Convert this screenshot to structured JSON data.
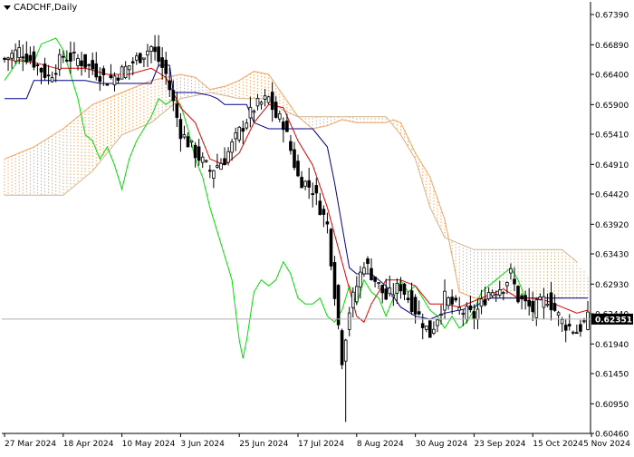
{
  "header": {
    "symbol_label": "CADCHF,Daily"
  },
  "colors": {
    "background": "#ffffff",
    "candle": "#000000",
    "tenkan": "#e00000",
    "kijun": "#00008b",
    "chikou": "#00dd00",
    "senkou_a": "#f4a460",
    "senkou_b": "#d2b48c",
    "price_tag": "#000000",
    "grid_frame": "#000000"
  },
  "chart_data": {
    "type": "candlestick",
    "symbol": "CADCHF",
    "timeframe": "Daily",
    "indicator": "Ichimoku Kinko Hyo",
    "ylim": [
      0.6046,
      0.676
    ],
    "y_ticks": [
      "0.67390",
      "0.66890",
      "0.66400",
      "0.65900",
      "0.65410",
      "0.64910",
      "0.64420",
      "0.63920",
      "0.63430",
      "0.62930",
      "0.62440",
      "0.61940",
      "0.61450",
      "0.60950",
      "0.60460"
    ],
    "x_ticks": [
      "27 Mar 2024",
      "18 Apr 2024",
      "10 May 2024",
      "3 Jun 2024",
      "25 Jun 2024",
      "17 Jul 2024",
      "8 Aug 2024",
      "30 Aug 2024",
      "23 Sep 2024",
      "15 Oct 2024",
      "5 Nov 2024"
    ],
    "x_tick_index": [
      0,
      16,
      32,
      48,
      64,
      80,
      96,
      112,
      128,
      144,
      160
    ],
    "current_price": "0.62351",
    "close_points": [
      [
        0,
        0.6665
      ],
      [
        4,
        0.668
      ],
      [
        8,
        0.666
      ],
      [
        12,
        0.6635
      ],
      [
        16,
        0.667
      ],
      [
        20,
        0.6665
      ],
      [
        24,
        0.665
      ],
      [
        28,
        0.663
      ],
      [
        32,
        0.6645
      ],
      [
        36,
        0.6665
      ],
      [
        40,
        0.6685
      ],
      [
        44,
        0.664
      ],
      [
        48,
        0.6545
      ],
      [
        52,
        0.651
      ],
      [
        56,
        0.648
      ],
      [
        60,
        0.65
      ],
      [
        64,
        0.6545
      ],
      [
        68,
        0.6585
      ],
      [
        72,
        0.66
      ],
      [
        74,
        0.657
      ],
      [
        76,
        0.656
      ],
      [
        80,
        0.647
      ],
      [
        84,
        0.645
      ],
      [
        88,
        0.639
      ],
      [
        92,
        0.617
      ],
      [
        94,
        0.625
      ],
      [
        96,
        0.629
      ],
      [
        98,
        0.633
      ],
      [
        100,
        0.631
      ],
      [
        104,
        0.627
      ],
      [
        108,
        0.629
      ],
      [
        112,
        0.625
      ],
      [
        116,
        0.621
      ],
      [
        120,
        0.627
      ],
      [
        124,
        0.625
      ],
      [
        128,
        0.624
      ],
      [
        132,
        0.628
      ],
      [
        136,
        0.629
      ],
      [
        138,
        0.631
      ],
      [
        140,
        0.627
      ],
      [
        144,
        0.625
      ],
      [
        148,
        0.627
      ],
      [
        152,
        0.623
      ],
      [
        156,
        0.6215
      ],
      [
        159,
        0.6235
      ]
    ],
    "tenkan_points": [
      [
        0,
        0.6665
      ],
      [
        8,
        0.666
      ],
      [
        14,
        0.665
      ],
      [
        22,
        0.665
      ],
      [
        28,
        0.664
      ],
      [
        34,
        0.664
      ],
      [
        40,
        0.665
      ],
      [
        44,
        0.6635
      ],
      [
        48,
        0.6585
      ],
      [
        52,
        0.656
      ],
      [
        56,
        0.65
      ],
      [
        60,
        0.649
      ],
      [
        64,
        0.651
      ],
      [
        68,
        0.656
      ],
      [
        72,
        0.659
      ],
      [
        76,
        0.6585
      ],
      [
        80,
        0.653
      ],
      [
        84,
        0.649
      ],
      [
        88,
        0.642
      ],
      [
        92,
        0.633
      ],
      [
        96,
        0.624
      ],
      [
        98,
        0.623
      ],
      [
        100,
        0.626
      ],
      [
        104,
        0.63
      ],
      [
        108,
        0.63
      ],
      [
        112,
        0.629
      ],
      [
        116,
        0.626
      ],
      [
        120,
        0.626
      ],
      [
        124,
        0.6255
      ],
      [
        128,
        0.6265
      ],
      [
        132,
        0.6275
      ],
      [
        136,
        0.6285
      ],
      [
        140,
        0.627
      ],
      [
        144,
        0.627
      ],
      [
        148,
        0.6265
      ],
      [
        152,
        0.6255
      ],
      [
        156,
        0.6245
      ],
      [
        159,
        0.625
      ]
    ],
    "kijun_points": [
      [
        0,
        0.66
      ],
      [
        6,
        0.66
      ],
      [
        8,
        0.663
      ],
      [
        12,
        0.663
      ],
      [
        16,
        0.663
      ],
      [
        22,
        0.663
      ],
      [
        26,
        0.6625
      ],
      [
        30,
        0.6625
      ],
      [
        34,
        0.6625
      ],
      [
        40,
        0.6625
      ],
      [
        42,
        0.6655
      ],
      [
        45,
        0.6655
      ],
      [
        46,
        0.661
      ],
      [
        52,
        0.661
      ],
      [
        56,
        0.6605
      ],
      [
        58,
        0.66
      ],
      [
        60,
        0.659
      ],
      [
        64,
        0.659
      ],
      [
        66,
        0.659
      ],
      [
        68,
        0.656
      ],
      [
        72,
        0.655
      ],
      [
        80,
        0.655
      ],
      [
        84,
        0.655
      ],
      [
        88,
        0.652
      ],
      [
        90,
        0.646
      ],
      [
        92,
        0.639
      ],
      [
        94,
        0.632
      ],
      [
        96,
        0.631
      ],
      [
        100,
        0.631
      ],
      [
        104,
        0.629
      ],
      [
        108,
        0.6255
      ],
      [
        112,
        0.624
      ],
      [
        116,
        0.6235
      ],
      [
        120,
        0.6245
      ],
      [
        128,
        0.6255
      ],
      [
        132,
        0.627
      ],
      [
        136,
        0.627
      ],
      [
        140,
        0.627
      ],
      [
        144,
        0.627
      ],
      [
        150,
        0.627
      ],
      [
        154,
        0.627
      ],
      [
        159,
        0.627
      ]
    ],
    "chikou_points": [
      [
        0,
        0.663
      ],
      [
        4,
        0.6665
      ],
      [
        8,
        0.666
      ],
      [
        10,
        0.669
      ],
      [
        14,
        0.67
      ],
      [
        16,
        0.668
      ],
      [
        20,
        0.66
      ],
      [
        22,
        0.654
      ],
      [
        24,
        0.653
      ],
      [
        26,
        0.65
      ],
      [
        28,
        0.652
      ],
      [
        30,
        0.649
      ],
      [
        32,
        0.645
      ],
      [
        34,
        0.65
      ],
      [
        36,
        0.653
      ],
      [
        38,
        0.655
      ],
      [
        40,
        0.657
      ],
      [
        42,
        0.66
      ],
      [
        44,
        0.659
      ],
      [
        46,
        0.66
      ],
      [
        48,
        0.659
      ],
      [
        50,
        0.655
      ],
      [
        52,
        0.65
      ],
      [
        54,
        0.647
      ],
      [
        56,
        0.642
      ],
      [
        58,
        0.638
      ],
      [
        60,
        0.634
      ],
      [
        62,
        0.63
      ],
      [
        64,
        0.62
      ],
      [
        65,
        0.617
      ],
      [
        66,
        0.62
      ],
      [
        68,
        0.628
      ],
      [
        70,
        0.63
      ],
      [
        72,
        0.629
      ],
      [
        74,
        0.63
      ],
      [
        76,
        0.633
      ],
      [
        78,
        0.631
      ],
      [
        80,
        0.627
      ],
      [
        82,
        0.626
      ],
      [
        84,
        0.626
      ],
      [
        86,
        0.627
      ],
      [
        88,
        0.624
      ],
      [
        90,
        0.623
      ],
      [
        92,
        0.625
      ],
      [
        94,
        0.629
      ],
      [
        96,
        0.626
      ],
      [
        98,
        0.63
      ],
      [
        100,
        0.628
      ],
      [
        102,
        0.627
      ],
      [
        104,
        0.624
      ],
      [
        106,
        0.627
      ],
      [
        108,
        0.63
      ],
      [
        110,
        0.628
      ],
      [
        112,
        0.629
      ],
      [
        114,
        0.627
      ],
      [
        116,
        0.625
      ],
      [
        118,
        0.624
      ],
      [
        120,
        0.622
      ],
      [
        122,
        0.624
      ],
      [
        124,
        0.622
      ],
      [
        126,
        0.623
      ],
      [
        128,
        0.625
      ],
      [
        130,
        0.628
      ],
      [
        132,
        0.629
      ],
      [
        134,
        0.63
      ],
      [
        136,
        0.631
      ],
      [
        138,
        0.632
      ],
      [
        140,
        0.63
      ],
      [
        142,
        0.627
      ],
      [
        144,
        0.625
      ],
      [
        145,
        0.624
      ]
    ],
    "senkou_a_points": [
      [
        0,
        0.65
      ],
      [
        8,
        0.652
      ],
      [
        16,
        0.655
      ],
      [
        24,
        0.659
      ],
      [
        32,
        0.661
      ],
      [
        40,
        0.663
      ],
      [
        48,
        0.664
      ],
      [
        52,
        0.6635
      ],
      [
        56,
        0.6615
      ],
      [
        60,
        0.662
      ],
      [
        64,
        0.663
      ],
      [
        68,
        0.6645
      ],
      [
        72,
        0.664
      ],
      [
        76,
        0.6605
      ],
      [
        80,
        0.657
      ],
      [
        84,
        0.655
      ],
      [
        88,
        0.6555
      ],
      [
        92,
        0.6565
      ],
      [
        96,
        0.656
      ],
      [
        100,
        0.656
      ],
      [
        104,
        0.656
      ],
      [
        106,
        0.6565
      ],
      [
        108,
        0.656
      ],
      [
        112,
        0.651
      ],
      [
        116,
        0.647
      ],
      [
        120,
        0.64
      ],
      [
        122,
        0.634
      ],
      [
        124,
        0.628
      ],
      [
        128,
        0.627
      ],
      [
        136,
        0.627
      ],
      [
        144,
        0.627
      ],
      [
        152,
        0.627
      ],
      [
        160,
        0.627
      ],
      [
        166,
        0.6265
      ]
    ],
    "senkou_b_points": [
      [
        0,
        0.644
      ],
      [
        8,
        0.644
      ],
      [
        16,
        0.644
      ],
      [
        24,
        0.648
      ],
      [
        32,
        0.654
      ],
      [
        40,
        0.656
      ],
      [
        48,
        0.66
      ],
      [
        56,
        0.661
      ],
      [
        64,
        0.66
      ],
      [
        68,
        0.66
      ],
      [
        72,
        0.66
      ],
      [
        76,
        0.658
      ],
      [
        80,
        0.657
      ],
      [
        84,
        0.657
      ],
      [
        88,
        0.657
      ],
      [
        92,
        0.657
      ],
      [
        96,
        0.657
      ],
      [
        100,
        0.657
      ],
      [
        104,
        0.657
      ],
      [
        108,
        0.654
      ],
      [
        112,
        0.65
      ],
      [
        116,
        0.642
      ],
      [
        120,
        0.637
      ],
      [
        124,
        0.636
      ],
      [
        128,
        0.635
      ],
      [
        136,
        0.635
      ],
      [
        144,
        0.635
      ],
      [
        152,
        0.635
      ],
      [
        156,
        0.633
      ],
      [
        160,
        0.63
      ],
      [
        166,
        0.628
      ]
    ]
  }
}
